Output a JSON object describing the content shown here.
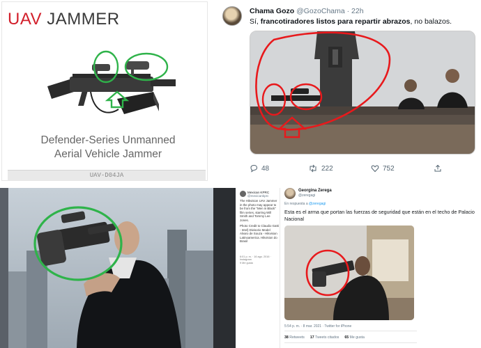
{
  "product": {
    "brand_part1": "UAV",
    "brand_part2": "JAMMER",
    "title_line1": "Defender-Series Unmanned",
    "title_line2": "Aerial Vehicle Jammer",
    "sku": "UAV-D04JA"
  },
  "tweet": {
    "author": "Chama Gozo",
    "handle": "@GozoChama",
    "time": "· 22h",
    "text_before": "Sí, ",
    "text_bold": "francotiradores listos para repartir abrazos",
    "text_after": ", no balazos.",
    "replies": "48",
    "retweets": "222",
    "likes": "752"
  },
  "side_tweet": {
    "author": "Mexican KPRC",
    "handle": "@mexicankprc",
    "text": "The Hikvision UAV Jammer in the photo may appear to be from the \"Men in Black\" film series, starring Will Smith and Tommy Lee Jones.",
    "credits": "Photo Credit to Claudio Gatti - Intel) Divisorio Model Alvaro de Souza - Hikvision Latinoamerica. Hikvision do Brasil",
    "meta": "6:01 p. m. · 16 ago. 2016 · Instagram",
    "meta2": "9 Me gusta"
  },
  "reply_tweet": {
    "author": "Georgina Zerega",
    "handle": "@zeregagi",
    "reply_prefix": "En respuesta a",
    "reply_to": "@zeregagi",
    "text": "Esta es el arma que portan las fuerzas de seguridad que están en el techo de Palacio Nacional",
    "meta": "5:54 p. m. · 8 mar. 2021 · Twitter for iPhone",
    "retweets_count": "38",
    "retweets_label": "Retweets",
    "quotes_count": "17",
    "quotes_label": "Tweets citados",
    "likes_count": "65",
    "likes_label": "Me gusta"
  },
  "colors": {
    "brand_red": "#d21f2b",
    "annotation_red": "#e8191c",
    "annotation_green": "#2fb34a",
    "twitter_blue": "#1d9bf0"
  }
}
